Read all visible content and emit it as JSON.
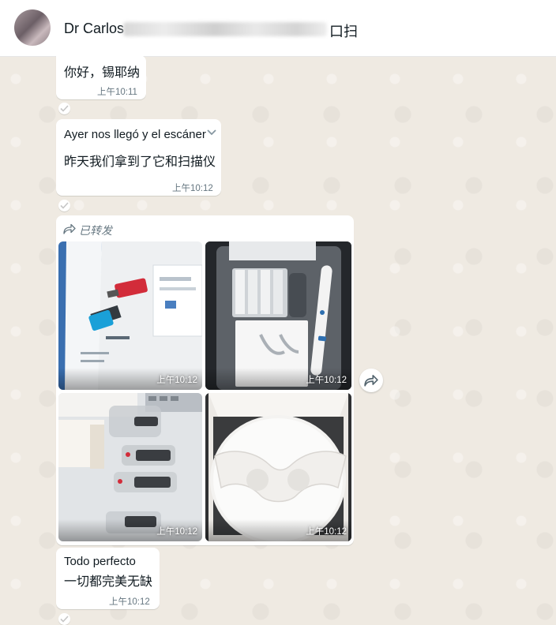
{
  "header": {
    "contact_name": "Dr Carlos",
    "contact_suffix": "口扫"
  },
  "messages": [
    {
      "text": "你好，锡耶纳",
      "time": "上午10:11"
    },
    {
      "text": "Ayer nos llegó y el escáner",
      "translation": "昨天我们拿到了它和扫描仪",
      "time": "上午10:12"
    },
    {
      "text_line1": "Todo perfecto",
      "text_line2": "一切都完美无缺",
      "time": "上午10:12"
    }
  ],
  "forwarded": {
    "label": "已转发",
    "photos": [
      {
        "time": "上午10:12"
      },
      {
        "time": "上午10:12"
      },
      {
        "time": "上午10:12"
      },
      {
        "time": "上午10:12"
      }
    ]
  },
  "icons": {
    "forward": "forward-arrow-icon",
    "share": "share-forward-icon",
    "check": "check-icon",
    "menu": "chevron-down-icon"
  }
}
